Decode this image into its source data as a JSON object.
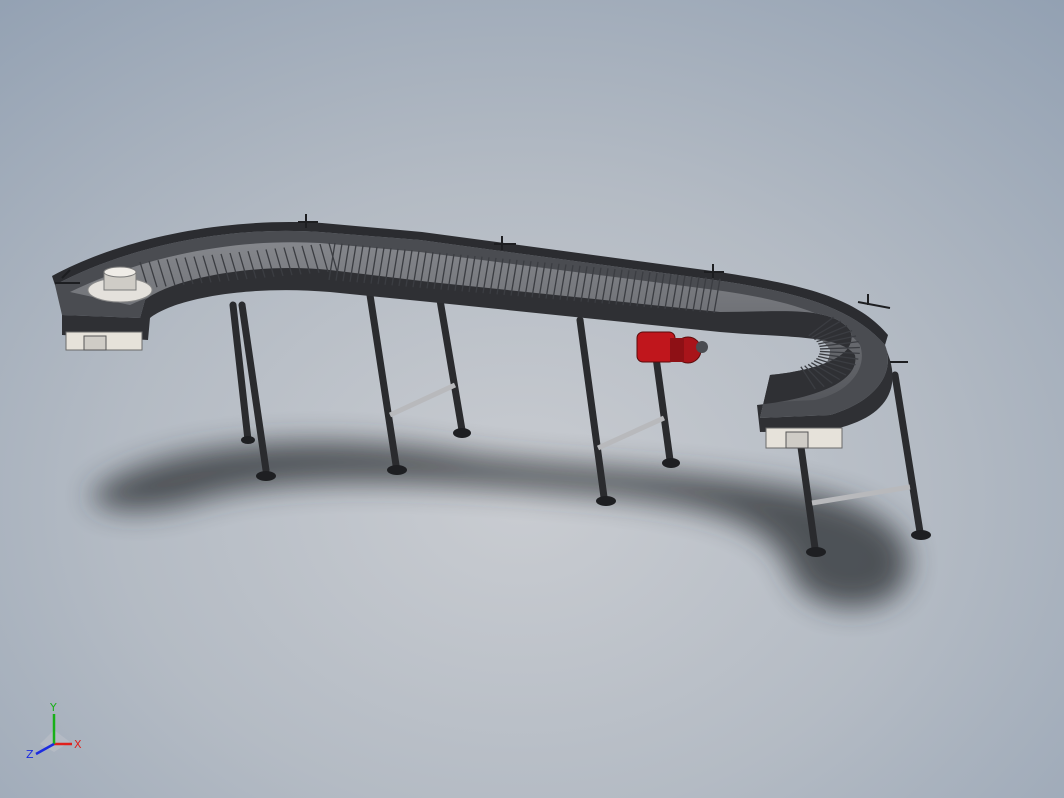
{
  "viewport": {
    "background_top": "#8e9db0",
    "background_bottom": "#c9ccd1"
  },
  "model": {
    "description_icon": "roller-conveyor-assembly",
    "frame_color": "#3a3c40",
    "roller_color": "#6e7075",
    "motor_color": "#c0161c",
    "base_color": "#e6e2da"
  },
  "triad": {
    "x_label": "X",
    "y_label": "Y",
    "z_label": "Z",
    "x_color": "#e0201c",
    "y_color": "#18b018",
    "z_color": "#1c2ce0"
  }
}
